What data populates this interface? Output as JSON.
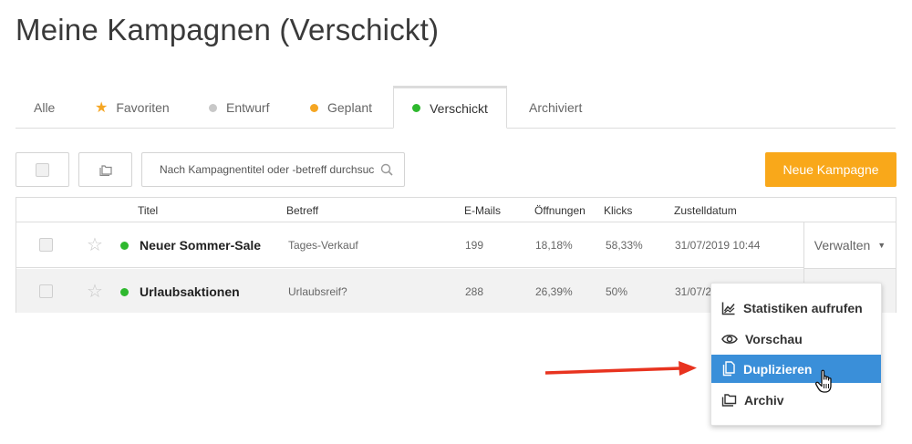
{
  "page": {
    "title": "Meine Kampagnen (Verschickt)"
  },
  "tabs": [
    {
      "label": "Alle"
    },
    {
      "label": "Favoriten",
      "icon": "star-icon",
      "color": "#f5a623"
    },
    {
      "label": "Entwurf",
      "icon": "dot",
      "color": "#c8c8c8"
    },
    {
      "label": "Geplant",
      "icon": "dot",
      "color": "#f5a623"
    },
    {
      "label": "Verschickt",
      "icon": "dot",
      "color": "#2eb82e",
      "active": true
    },
    {
      "label": "Archiviert"
    }
  ],
  "toolbar": {
    "search_placeholder": "Nach Kampagnentitel oder -betreff durchsuc",
    "new_campaign_label": "Neue Kampagne",
    "accent_color": "#f9a81a"
  },
  "table": {
    "columns": [
      "Titel",
      "Betreff",
      "E-Mails",
      "Öffnungen",
      "Klicks",
      "Zustelldatum"
    ],
    "rows": [
      {
        "title": "Neuer Sommer-Sale",
        "subject": "Tages-Verkauf",
        "emails": "199",
        "opens": "18,18%",
        "clicks": "58,33%",
        "date": "31/07/2019 10:44"
      },
      {
        "title": "Urlaubsaktionen",
        "subject": "Urlaubsreif?",
        "emails": "288",
        "opens": "26,39%",
        "clicks": "50%",
        "date": "31/07/2"
      }
    ],
    "manage_label": "Verwalten"
  },
  "dropdown": {
    "items": [
      {
        "label": "Statistiken aufrufen",
        "icon": "chart-icon"
      },
      {
        "label": "Vorschau",
        "icon": "eye-icon"
      },
      {
        "label": "Duplizieren",
        "icon": "copy-icon",
        "highlighted": true
      },
      {
        "label": "Archiv",
        "icon": "folder-icon"
      }
    ],
    "highlight_color": "#3a8fd9"
  }
}
